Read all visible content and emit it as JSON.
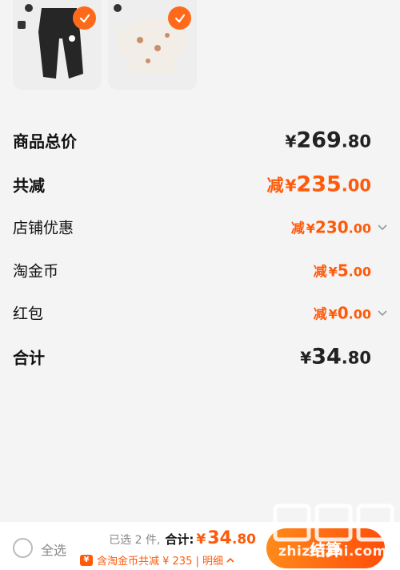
{
  "products": [
    {
      "name": "pants",
      "selected": true
    },
    {
      "name": "sweater",
      "selected": true
    }
  ],
  "summary": {
    "total_label": "商品总价",
    "total_yen": "¥",
    "total_int": "269",
    "total_dec": ".80",
    "discount_label": "共减",
    "discount_prefix": "减",
    "discount_yen": "¥",
    "discount_int": "235",
    "discount_dec": ".00",
    "store_label": "店铺优惠",
    "store_prefix": "减",
    "store_yen": "¥",
    "store_int": "230",
    "store_dec": ".00",
    "coin_label": "淘金币",
    "coin_prefix": "减",
    "coin_yen": "¥",
    "coin_int": "5",
    "coin_dec": ".00",
    "redpack_label": "红包",
    "redpack_prefix": "减",
    "redpack_yen": "¥",
    "redpack_int": "0",
    "redpack_dec": ".00",
    "sum_label": "合计",
    "sum_yen": "¥",
    "sum_int": "34",
    "sum_dec": ".80"
  },
  "bottom_bar": {
    "select_all": "全选",
    "selected_text": "已选 2 件,",
    "total_label": "合计:",
    "total_yen": "¥",
    "total_int": "34",
    "total_dec": ".80",
    "detail_text": "含淘金币共减 ¥ 235 | 明细",
    "coin_icon_text": "¥",
    "checkout_label": "结算"
  },
  "watermark": {
    "text": "zhizhizhi.com"
  },
  "colors": {
    "accent": "#ff5a0a",
    "background": "#f4f4f4"
  }
}
